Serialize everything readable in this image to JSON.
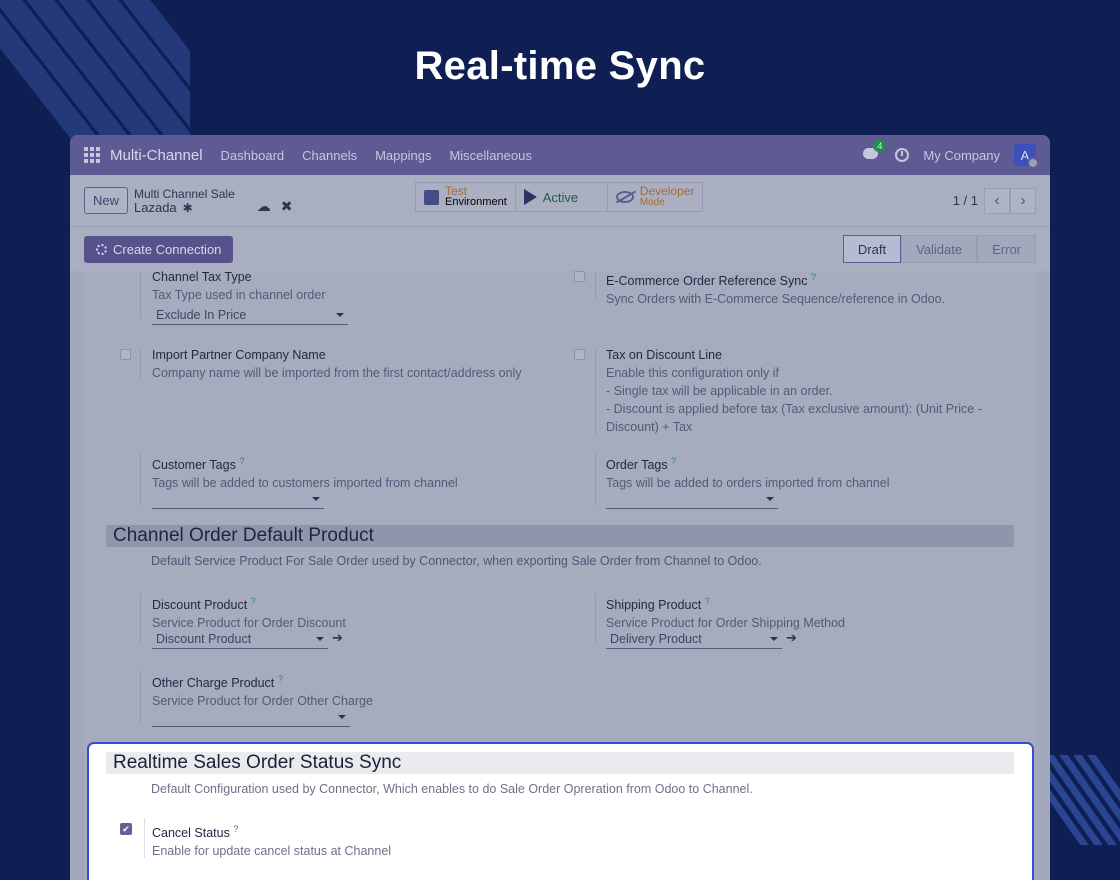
{
  "headline": "Real-time Sync",
  "navbar": {
    "app_name": "Multi-Channel",
    "menus": [
      "Dashboard",
      "Channels",
      "Mappings",
      "Miscellaneous"
    ],
    "chat_count": "4",
    "company": "My Company",
    "avatar_letter": "A"
  },
  "control_panel": {
    "new_label": "New",
    "breadcrumb_parent": "Multi Channel Sale",
    "record_name": "Lazada",
    "smart_buttons": {
      "test_line1": "Test",
      "test_line2": "Environment",
      "active": "Active",
      "dev_line1": "Developer",
      "dev_line2": "Mode"
    },
    "pager": "1 / 1"
  },
  "statusbar": {
    "create_connection": "Create Connection",
    "stages": [
      "Draft",
      "Validate",
      "Error"
    ],
    "active_stage": "Draft"
  },
  "form": {
    "channel_tax_type": {
      "label": "Channel Tax Type",
      "help": "Tax Type used in channel order",
      "value": "Exclude In Price"
    },
    "ecom_ref_sync": {
      "label": "E-Commerce Order Reference Sync",
      "help": "Sync Orders with E-Commerce Sequence/reference in Odoo."
    },
    "import_partner": {
      "label": "Import Partner Company Name",
      "help": "Company name will be imported from the first contact/address only"
    },
    "tax_discount": {
      "label": "Tax on Discount Line",
      "help1": "Enable this configuration only if",
      "help2": "- Single tax will be applicable in an order.",
      "help3": "- Discount is applied before tax (Tax exclusive amount): (Unit Price -",
      "help4": "Discount) + Tax"
    },
    "customer_tags": {
      "label": "Customer Tags",
      "help": "Tags will be added to customers imported from channel"
    },
    "order_tags": {
      "label": "Order Tags",
      "help": "Tags will be added to orders imported from channel"
    },
    "default_product_section": {
      "title": "Channel Order Default Product",
      "help": "Default Service Product For Sale Order used by Connector, when exporting Sale Order from Channel to Odoo."
    },
    "discount_product": {
      "label": "Discount Product",
      "help": "Service Product for Order Discount",
      "value": "Discount Product"
    },
    "shipping_product": {
      "label": "Shipping Product",
      "help": "Service Product for Order Shipping Method",
      "value": "Delivery Product"
    },
    "other_charge": {
      "label": "Other Charge Product",
      "help": "Service Product for Order Other Charge"
    },
    "q": "?"
  },
  "realtime": {
    "title": "Realtime Sales Order Status Sync",
    "help": "Default Configuration used by Connector, Which enables to do Sale Order Opreration from Odoo to Channel.",
    "cancel_label": "Cancel Status",
    "cancel_help": "Enable for update cancel status at Channel",
    "cancel_checked": true
  }
}
